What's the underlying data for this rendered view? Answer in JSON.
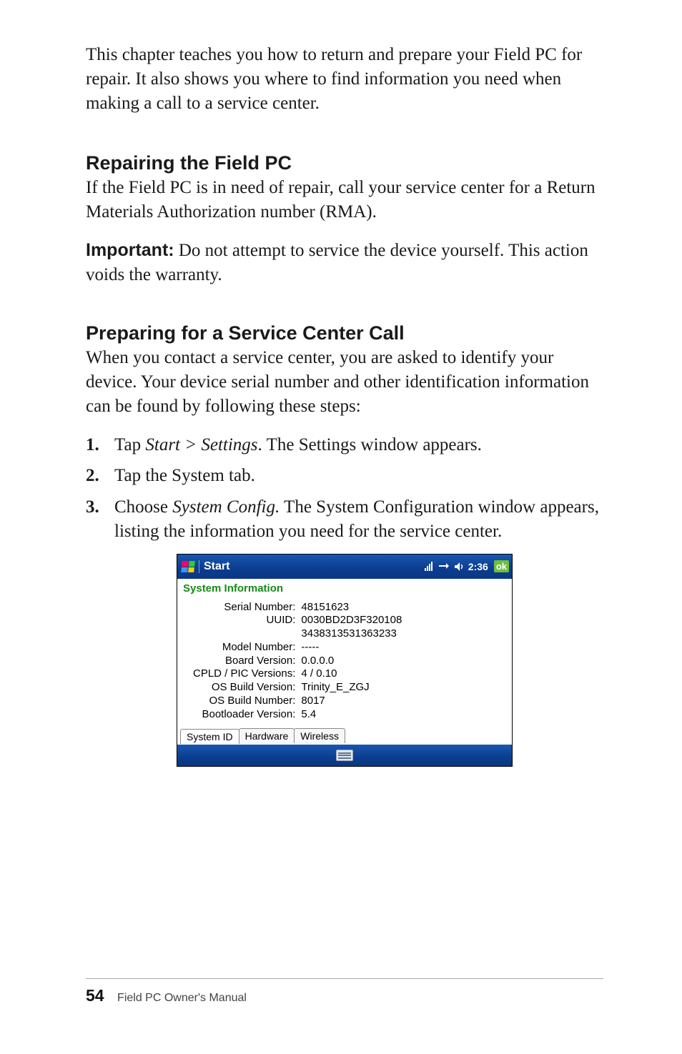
{
  "intro": "This chapter teaches you how to return and prepare your Field PC for repair. It also shows you where to find information you need when making a call to a service center.",
  "section1": {
    "heading": "Repairing the Field PC",
    "body": "If the Field PC is in need of repair, call your service center for a Return Materials Authorization number (RMA).",
    "important_label": "Important:",
    "important_text": "  Do not attempt to service the device yourself. This action voids the warranty."
  },
  "section2": {
    "heading": "Preparing for a Service Center Call",
    "body": "When you contact a service center, you are asked to identify your device. Your device serial number and other identification information can be found by following these steps:",
    "steps": {
      "s1_pre": "Tap ",
      "s1_ital": "Start > Settings",
      "s1_post": ". The Settings window appears.",
      "s2": "Tap the System tab.",
      "s3_pre": "Choose ",
      "s3_ital": "System Config.",
      "s3_post": " The System Configuration window appears, listing the information you need for the service center."
    }
  },
  "screenshot": {
    "start_label": "Start",
    "clock": "2:36",
    "ok": "ok",
    "section_title": "System Information",
    "rows": {
      "serial_k": "Serial Number:",
      "serial_v": "48151623",
      "uuid_k": "UUID:",
      "uuid_v1": "0030BD2D3F320108",
      "uuid_v2": "3438313531363233",
      "model_k": "Model Number:",
      "model_v": "-----",
      "board_k": "Board Version:",
      "board_v": "0.0.0.0",
      "cpld_k": "CPLD / PIC Versions:",
      "cpld_v": "4 / 0.10",
      "osbv_k": "OS Build Version:",
      "osbv_v": "Trinity_E_ZGJ",
      "osbn_k": "OS Build Number:",
      "osbn_v": "8017",
      "boot_k": "Bootloader Version:",
      "boot_v": "5.4"
    },
    "tabs": {
      "t1": "System ID",
      "t2": "Hardware",
      "t3": "Wireless"
    }
  },
  "footer": {
    "page_number": "54",
    "doc_title": "Field PC Owner's Manual"
  }
}
